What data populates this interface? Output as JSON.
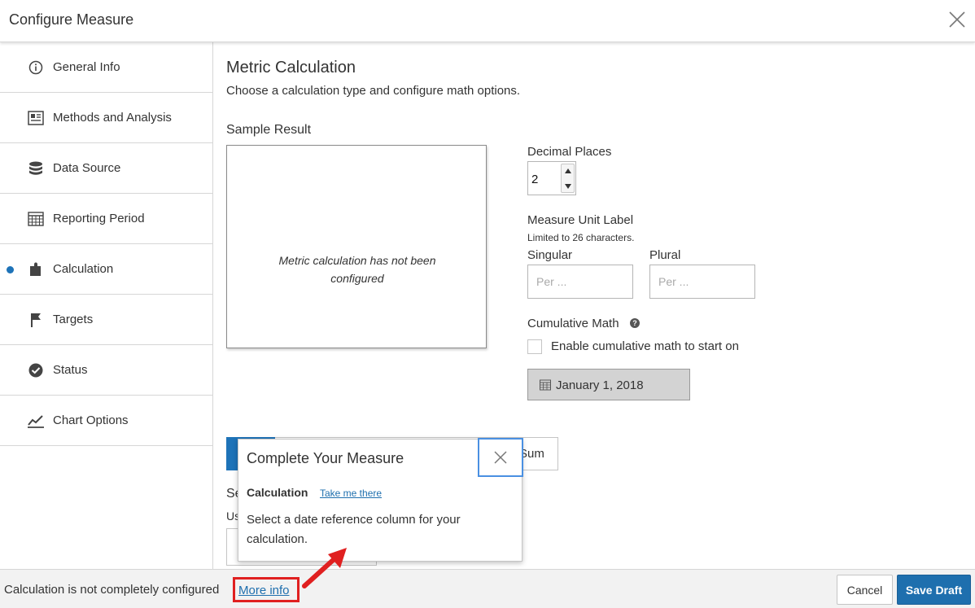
{
  "header": {
    "title": "Configure Measure"
  },
  "sidebar": {
    "items": [
      {
        "label": "General Info",
        "icon": "info-icon"
      },
      {
        "label": "Methods and Analysis",
        "icon": "document-icon"
      },
      {
        "label": "Data Source",
        "icon": "database-icon"
      },
      {
        "label": "Reporting Period",
        "icon": "calendar-icon"
      },
      {
        "label": "Calculation",
        "icon": "puzzle-icon",
        "active": true
      },
      {
        "label": "Targets",
        "icon": "flag-icon"
      },
      {
        "label": "Status",
        "icon": "check-circle-icon"
      },
      {
        "label": "Chart Options",
        "icon": "line-chart-icon"
      }
    ]
  },
  "main": {
    "heading": "Metric Calculation",
    "description": "Choose a calculation type and configure math options.",
    "sample_heading": "Sample Result",
    "sample_message": "Metric calculation has not been configured",
    "decimal_places": {
      "label": "Decimal Places",
      "value": "2"
    },
    "unit_label": {
      "label": "Measure Unit Label",
      "hint": "Limited to 26 characters.",
      "singular_label": "Singular",
      "singular_placeholder": "Per ...",
      "plural_label": "Plural",
      "plural_placeholder": "Per ..."
    },
    "cumulative": {
      "label": "Cumulative Math",
      "checkbox_label": "Enable cumulative math to start on",
      "date": "January 1, 2018"
    },
    "tab_partial": "Sum",
    "section_partial": "Se",
    "subtext_partial": "Us"
  },
  "popover": {
    "title": "Complete Your Measure",
    "section": "Calculation",
    "link": "Take me there",
    "body": "Select a date reference column for your calculation."
  },
  "footer": {
    "status": "Calculation is not completely configured",
    "more_info": "More info",
    "cancel": "Cancel",
    "save": "Save Draft"
  },
  "colors": {
    "accent": "#1e73b8",
    "highlight": "#e02020",
    "focus": "#4a90e2"
  }
}
